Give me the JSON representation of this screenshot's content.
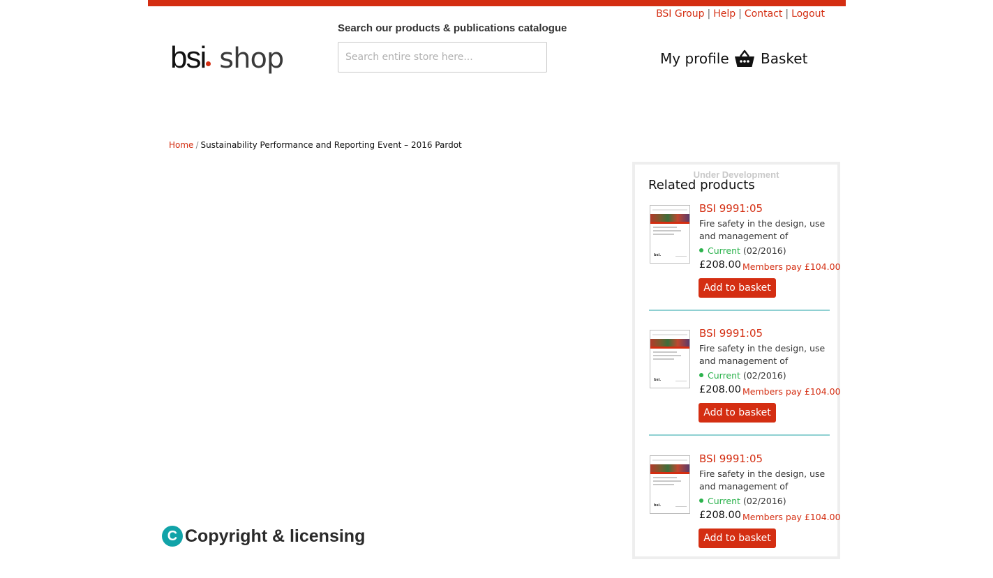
{
  "colors": {
    "brand_red": "#d42e12",
    "status_green": "#2bb24c",
    "divider_teal": "#8fd0d2",
    "copyright_teal": "#11a3a8"
  },
  "top_links": [
    "BSI Group",
    "Help",
    "Contact",
    "Logout"
  ],
  "logo": {
    "brand": "bsi",
    "suffix": "shop"
  },
  "search": {
    "label": "Search our products & publications catalogue",
    "placeholder": "Search entire store here...",
    "value": ""
  },
  "header": {
    "profile_label": "My profile",
    "basket_label": "Basket",
    "basket_icon": "basket-icon"
  },
  "breadcrumb": {
    "home": "Home",
    "separator": "/",
    "current": "Sustainability Performance and Reporting Event – 2016 Pardot"
  },
  "related": {
    "notice": "Under Development",
    "title": "Related products",
    "items": [
      {
        "code": "BSI 9991:05",
        "description": "Fire safety in the design, use and management of residential waste",
        "status": "Current",
        "date": "(02/2016)",
        "price": "£208.00",
        "member_price": "Members pay £104.00",
        "add_label": "Add to basket"
      },
      {
        "code": "BSI 9991:05",
        "description": "Fire safety in the design, use and management of residential waste",
        "status": "Current",
        "date": "(02/2016)",
        "price": "£208.00",
        "member_price": "Members pay £104.00",
        "add_label": "Add to basket"
      },
      {
        "code": "BSI 9991:05",
        "description": "Fire safety in the design, use and management of residential waste",
        "status": "Current",
        "date": "(02/2016)",
        "price": "£208.00",
        "member_price": "Members pay £104.00",
        "add_label": "Add to basket"
      }
    ]
  },
  "copyright": {
    "icon_letter": "C",
    "title": "Copyright & licensing"
  }
}
